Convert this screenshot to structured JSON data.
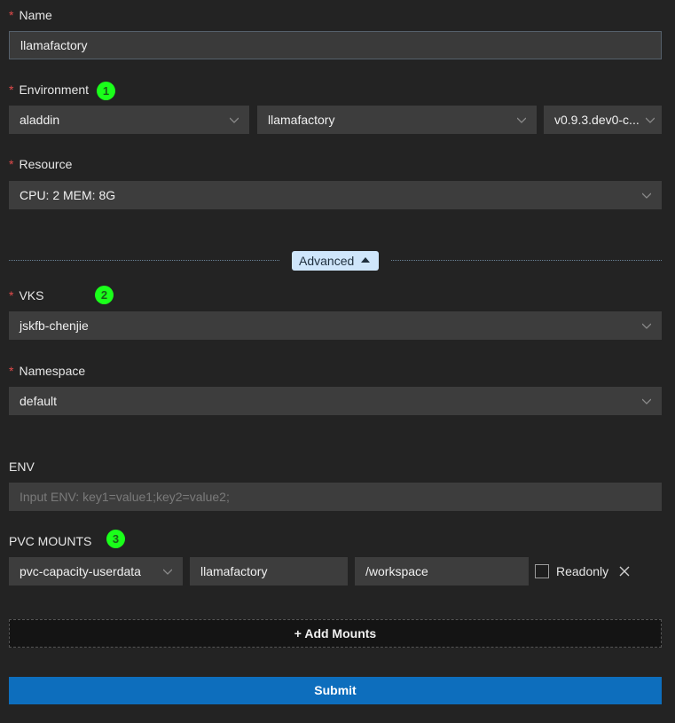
{
  "name": {
    "label": "Name",
    "value": "llamafactory"
  },
  "environment": {
    "label": "Environment",
    "badge": "1",
    "select1": "aladdin",
    "select2": "llamafactory",
    "select3": "v0.9.3.dev0-c..."
  },
  "resource": {
    "label": "Resource",
    "value": "CPU: 2 MEM: 8G"
  },
  "advanced": {
    "label": "Advanced"
  },
  "vks": {
    "label": "VKS",
    "badge": "2",
    "value": "jskfb-chenjie"
  },
  "namespace": {
    "label": "Namespace",
    "value": "default"
  },
  "env": {
    "label": "ENV",
    "placeholder": "Input ENV: key1=value1;key2=value2;"
  },
  "pvc": {
    "label": "PVC MOUNTS",
    "badge": "3",
    "mounts": [
      {
        "pvc": "pvc-capacity-userdata",
        "sub_path": "llamafactory",
        "mount_path": "/workspace",
        "readonly_label": "Readonly",
        "readonly": false
      }
    ],
    "add_label": "+ Add Mounts"
  },
  "submit_label": "Submit",
  "colors": {
    "accent": "#0d6ebd",
    "badge": "#1aff1a",
    "required": "#e04a4a"
  }
}
